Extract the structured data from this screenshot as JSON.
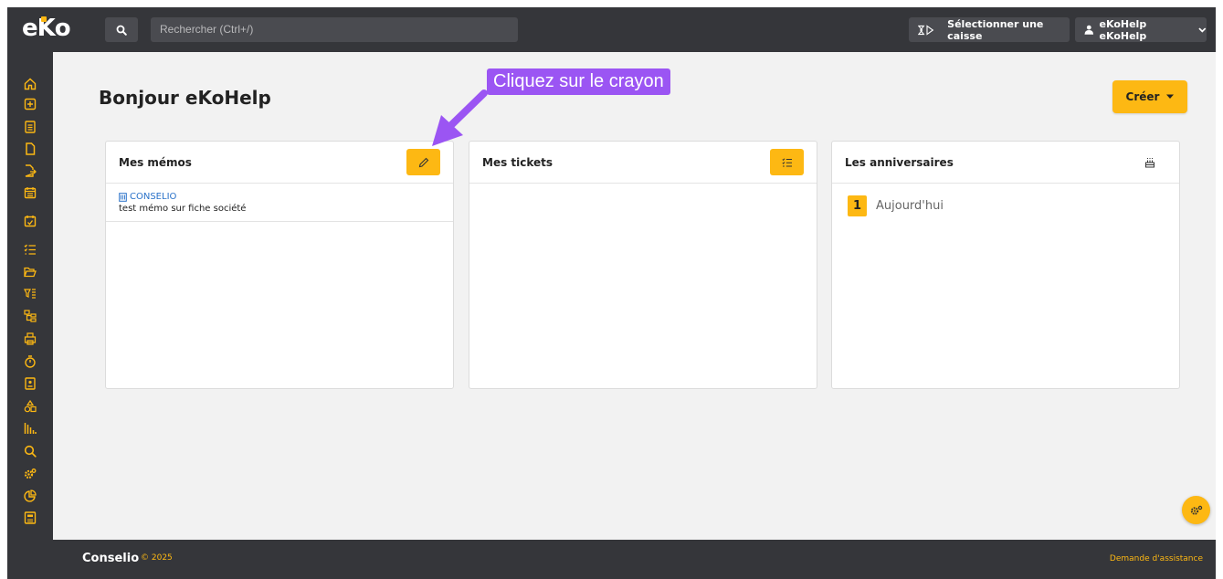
{
  "header": {
    "logo": "eko",
    "search_placeholder": "Rechercher (Ctrl+/)",
    "caisse_label": "Sélectionner une caisse",
    "user_label": "eKoHelp eKoHelp"
  },
  "sidebar": {
    "items": [
      "home-icon",
      "add-box-icon",
      "document-list-icon",
      "file-icon",
      "file-export-icon",
      "calendar-icon",
      "calendar-check-icon",
      "tasks-list-icon",
      "folder-open-icon",
      "filter-list-icon",
      "tree-structure-icon",
      "printer-icon",
      "stopwatch-icon",
      "contact-card-icon",
      "shapes-icon",
      "bar-chart-icon",
      "search-icon",
      "settings-gear-icon",
      "pie-chart-icon",
      "calculator-icon"
    ]
  },
  "main": {
    "title": "Bonjour eKoHelp",
    "create_label": "Créer",
    "panels": {
      "memos": {
        "title": "Mes mémos",
        "items": [
          {
            "company": "CONSELIO",
            "text": "test mémo sur fiche société"
          }
        ]
      },
      "tickets": {
        "title": "Mes tickets"
      },
      "birthdays": {
        "title": "Les anniversaires",
        "count": "1",
        "label": "Aujourd'hui"
      }
    }
  },
  "annotation": {
    "text": "Cliquez sur le crayon"
  },
  "footer": {
    "brand": "Conselio",
    "year": "© 2025",
    "help": "Demande d'assistance"
  },
  "colors": {
    "accent": "#fdb813",
    "topbar": "#35363a",
    "background": "#f2f2f2",
    "link": "#2a72c9",
    "callout": "#9b55f3"
  }
}
